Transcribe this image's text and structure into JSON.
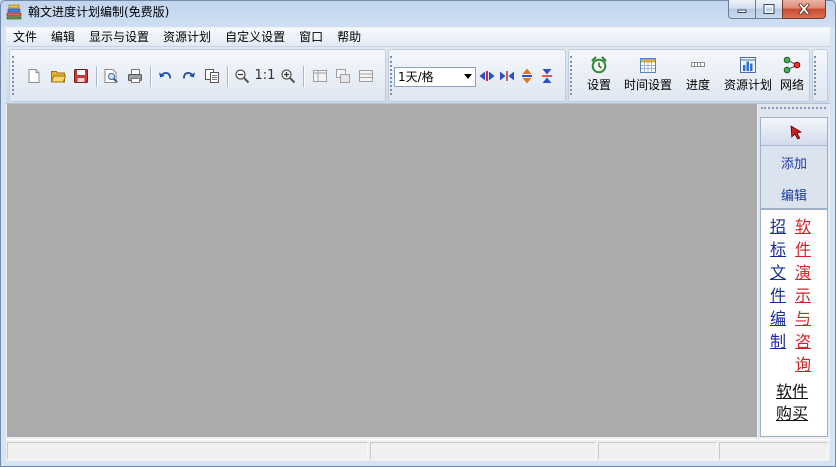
{
  "window": {
    "title": "翰文进度计划编制(免费版)",
    "app_icon": "app-logo-icon",
    "controls": {
      "minimize": "minimize-icon",
      "maximize": "maximize-icon",
      "close": "close-icon"
    }
  },
  "menu": {
    "items": [
      "文件",
      "编辑",
      "显示与设置",
      "资源计划",
      "自定义设置",
      "窗口",
      "帮助"
    ]
  },
  "toolbar": {
    "standard_tools": [
      "new-file-icon",
      "open-folder-icon",
      "save-icon",
      "print-preview-icon",
      "print-icon",
      "undo-icon",
      "redo-icon",
      "copy-icon",
      "zoom-out-icon",
      "zoom-in-icon"
    ],
    "zoom_reset_label": "1:1",
    "disabled_view_tools": [
      "split-columns-icon",
      "cascade-windows-icon",
      "split-rows-icon"
    ],
    "scale_select": {
      "value": "1天/格"
    },
    "timeline_tools": [
      "expand-horizontal-icon",
      "shrink-horizontal-icon",
      "expand-vertical-icon",
      "shrink-vertical-icon"
    ],
    "big_buttons": [
      {
        "label": "设置",
        "icon": "alarm-clock-icon"
      },
      {
        "label": "时间设置",
        "icon": "calendar-icon"
      },
      {
        "label": "进度",
        "icon": "progress-icon"
      },
      {
        "label": "资源计划",
        "icon": "resource-chart-icon"
      },
      {
        "label": "网络",
        "icon": "network-icon"
      }
    ]
  },
  "side_panel": {
    "pointer_tool": "pointer-arrow-icon",
    "add_label": "添加",
    "edit_label": "编辑",
    "label_color": "#1d3a9e",
    "links": [
      {
        "text": "招标文件编制",
        "color": "#1a2b9b"
      },
      {
        "text": "软件演示与咨询",
        "color": "#d1232a"
      },
      {
        "text": "软件购买",
        "color": "#111111"
      }
    ]
  },
  "colors": {
    "workspace": "#ababab",
    "title_bar": "#c9daef",
    "close_button": "#c9462c"
  }
}
